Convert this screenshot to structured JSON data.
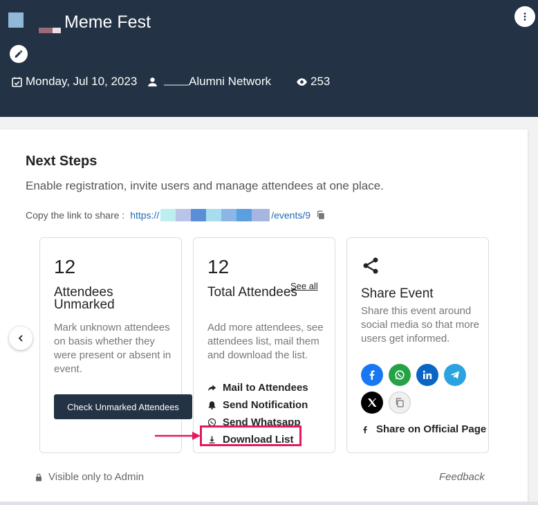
{
  "header": {
    "title": "Meme Fest",
    "date": "Monday, Jul 10, 2023",
    "organizer": "Alumni Network",
    "views": "253"
  },
  "next_steps": {
    "heading": "Next Steps",
    "subtitle": "Enable registration, invite users and manage attendees at one place.",
    "share_label": "Copy the link to share :",
    "link_prefix": "https://",
    "link_suffix": "/events/9"
  },
  "tiles": {
    "unmarked": {
      "count": "12",
      "title": "Attendees Unmarked",
      "description": "Mark unknown attendees on basis whether they were present or absent in event.",
      "button": "Check Unmarked Attendees"
    },
    "total": {
      "count": "12",
      "title": "Total Attendees",
      "see_all": "See all",
      "description": "Add more attendees, see attendees list, mail them and download the list.",
      "actions": [
        "Mail to Attendees",
        "Send Notification",
        "Send Whatsapp",
        "Download List"
      ]
    },
    "share": {
      "title": "Share Event",
      "description": "Share this event around social media so that more users get informed.",
      "official": "Share on Official Page"
    }
  },
  "footer": {
    "visibility": "Visible only to Admin",
    "feedback": "Feedback"
  },
  "colors": {
    "header_bg": "#233244",
    "link": "#1f6bb5",
    "highlight": "#e3195f",
    "facebook": "#1877f2",
    "whatsapp": "#25a244",
    "linkedin": "#0a66c2",
    "telegram": "#2aa3e0"
  },
  "icons": [
    "calendar-icon",
    "user-icon",
    "eye-icon",
    "edit-icon",
    "more-vertical-icon",
    "copy-icon",
    "share-icon",
    "forward-icon",
    "bell-icon",
    "whatsapp-icon",
    "download-icon",
    "facebook-icon",
    "linkedin-icon",
    "telegram-icon",
    "x-icon",
    "lock-icon",
    "chevron-left-icon"
  ]
}
